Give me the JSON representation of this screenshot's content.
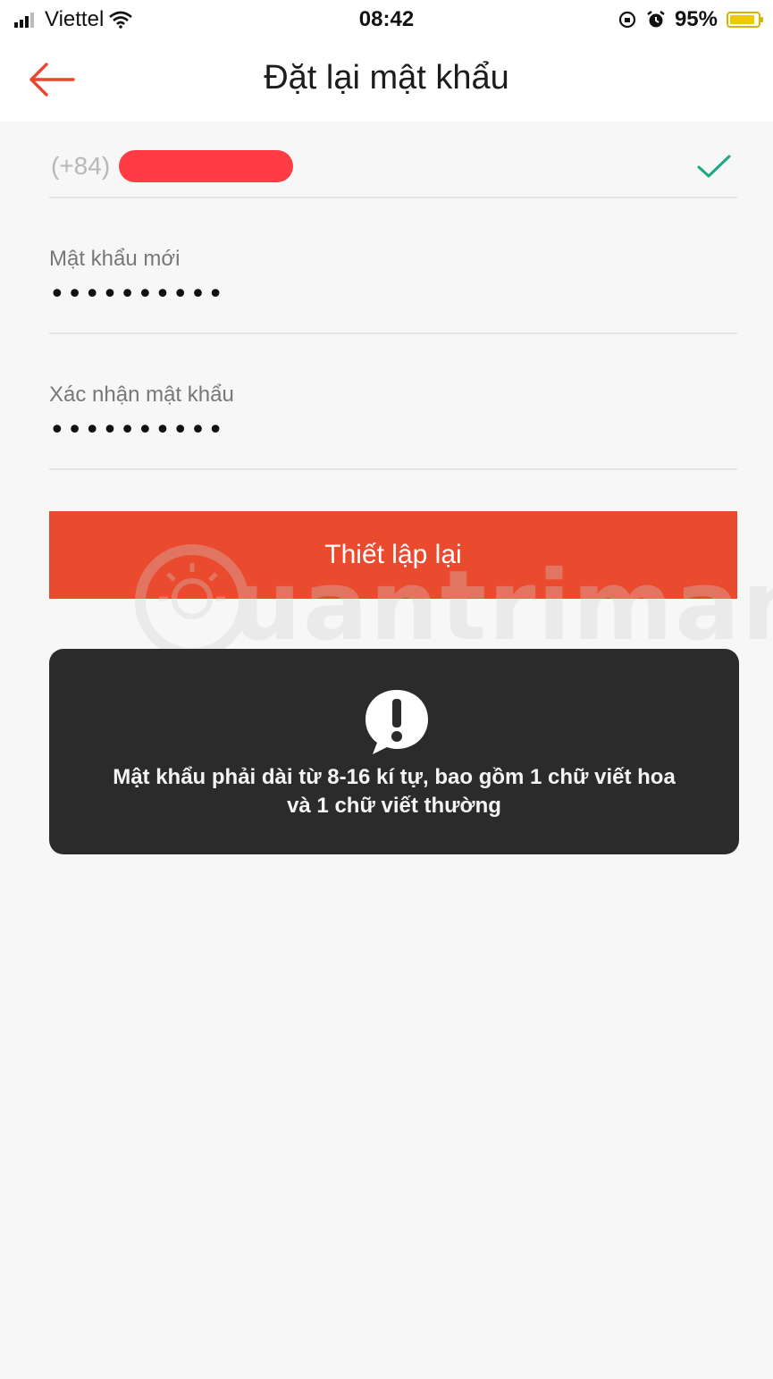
{
  "status_bar": {
    "carrier": "Viettel",
    "time": "08:42",
    "battery_percent": "95%",
    "battery_level": 0.95
  },
  "nav": {
    "title": "Đặt lại mật khẩu"
  },
  "form": {
    "phone_prefix": "(+84)",
    "new_password_label": "Mật khẩu mới",
    "new_password_value": "••••••••••",
    "confirm_password_label": "Xác nhận mật khẩu",
    "confirm_password_value": "••••••••••",
    "submit_label": "Thiết lập lại"
  },
  "toast": {
    "line1": "Mật khẩu phải dài từ 8-16 kí tự, bao gồm 1 chữ viết hoa",
    "line2": "và 1 chữ viết thường"
  },
  "watermark": {
    "text": "uantrimang"
  },
  "colors": {
    "accent": "#ea4a2d",
    "check": "#1aa882",
    "toast_bg": "#2b2b2b"
  }
}
